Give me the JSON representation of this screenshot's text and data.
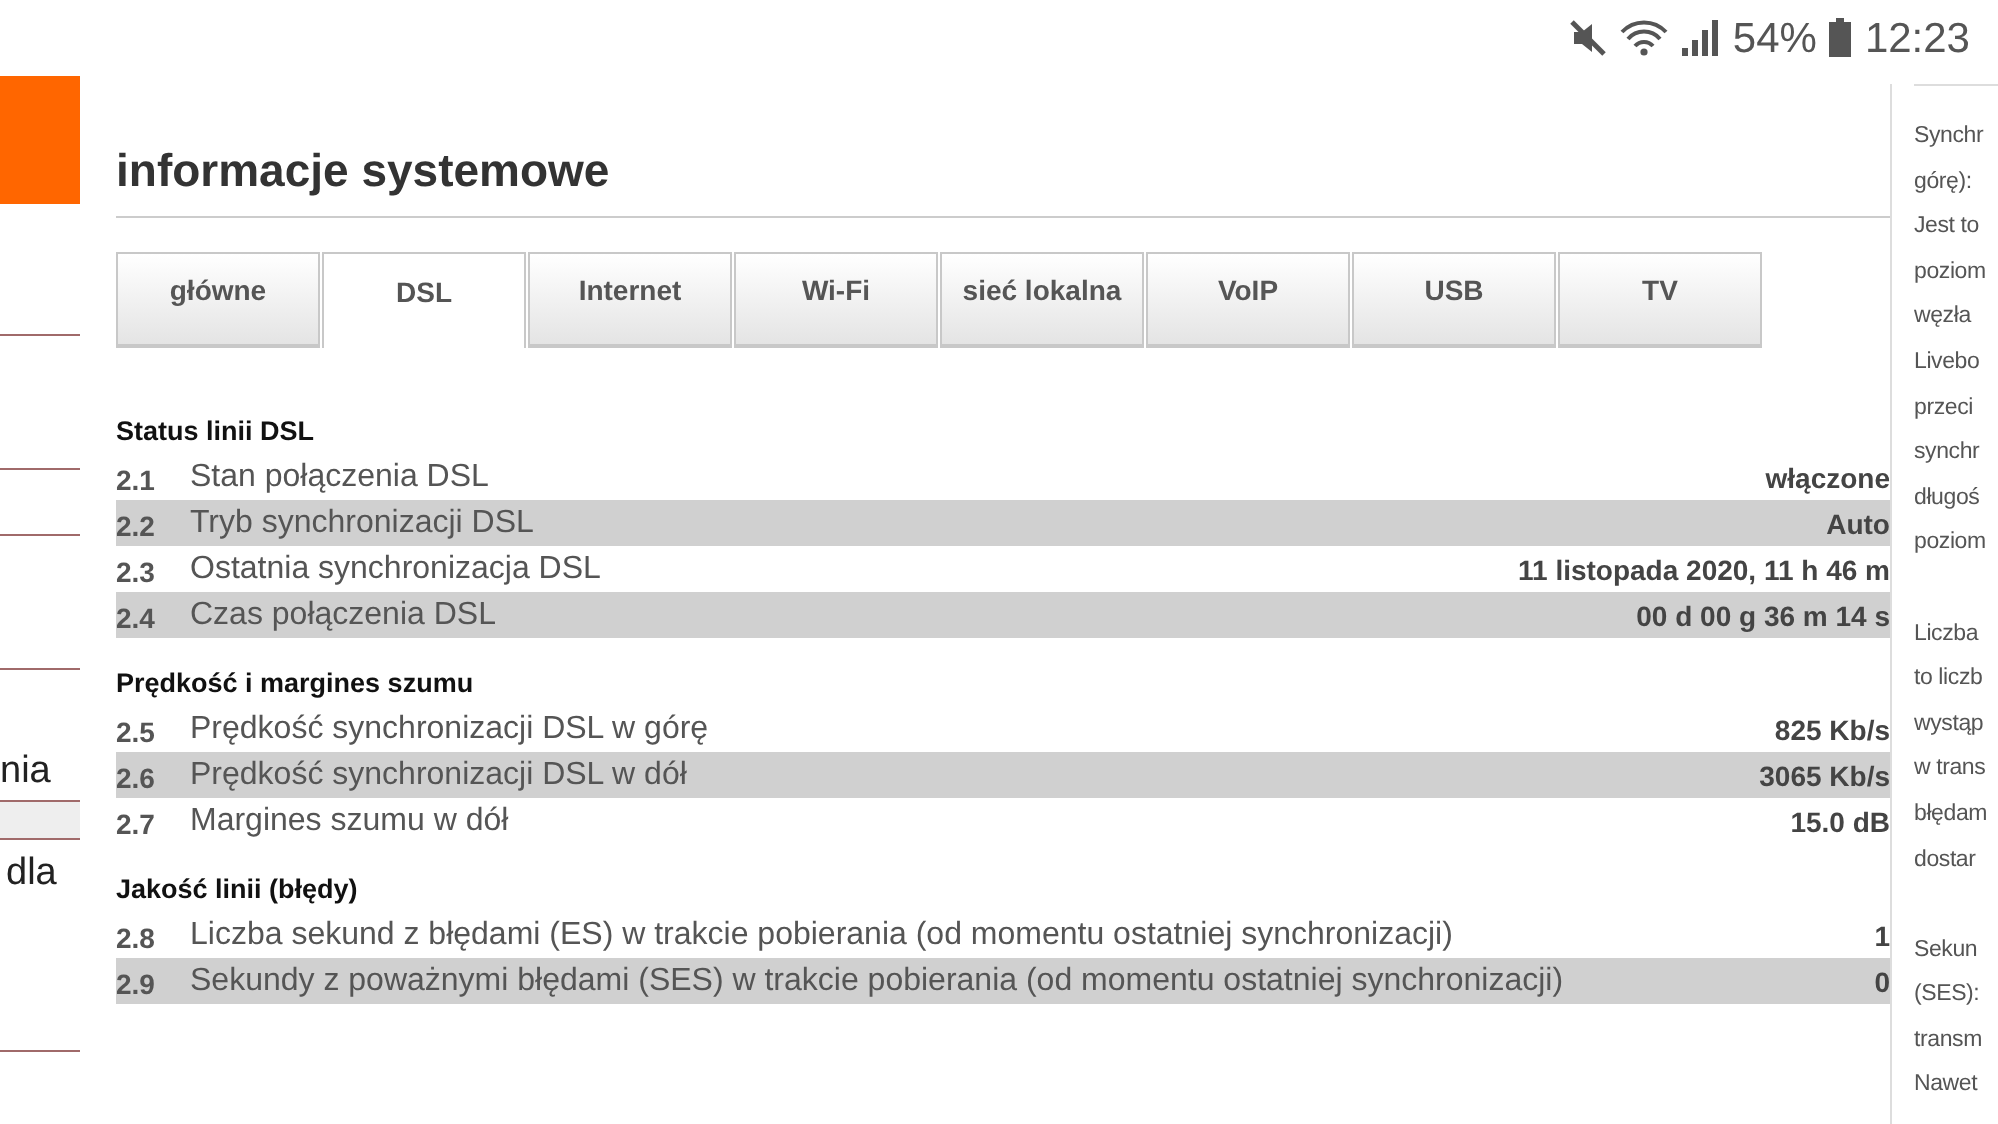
{
  "status_bar": {
    "battery": "54%",
    "time": "12:23"
  },
  "sidebar": {
    "items": [
      "nia",
      "dla"
    ]
  },
  "page": {
    "title": "informacje systemowe",
    "tabs": [
      {
        "label": "główne",
        "selected": false
      },
      {
        "label": "DSL",
        "selected": true
      },
      {
        "label": "Internet",
        "selected": false
      },
      {
        "label": "Wi-Fi",
        "selected": false
      },
      {
        "label": "sieć lokalna",
        "selected": false
      },
      {
        "label": "VoIP",
        "selected": false
      },
      {
        "label": "USB",
        "selected": false
      },
      {
        "label": "TV",
        "selected": false
      }
    ],
    "sections": [
      {
        "heading": "Status linii DSL",
        "rows": [
          {
            "number": "2.1",
            "label": "Stan połączenia DSL",
            "value": "włączone"
          },
          {
            "number": "2.2",
            "label": "Tryb synchronizacji DSL",
            "value": "Auto"
          },
          {
            "number": "2.3",
            "label": "Ostatnia synchronizacja DSL",
            "value": "11 listopada 2020, 11 h 46 m"
          },
          {
            "number": "2.4",
            "label": "Czas połączenia DSL",
            "value": "00 d 00 g 36 m 14 s"
          }
        ]
      },
      {
        "heading": "Prędkość i margines szumu",
        "rows": [
          {
            "number": "2.5",
            "label": "Prędkość synchronizacji DSL w górę",
            "value": "825 Kb/s"
          },
          {
            "number": "2.6",
            "label": "Prędkość synchronizacji DSL w dół",
            "value": "3065 Kb/s"
          },
          {
            "number": "2.7",
            "label": "Margines szumu w dół",
            "value": "15.0 dB"
          }
        ]
      },
      {
        "heading": "Jakość linii (błędy)",
        "rows": [
          {
            "number": "2.8",
            "label": "Liczba sekund z błędami (ES) w trakcie pobierania (od momentu ostatniej synchronizacji)",
            "value": "1"
          },
          {
            "number": "2.9",
            "label": "Sekundy z poważnymi błędami (SES) w trakcie pobierania (od momentu ostatniej synchronizacji)",
            "value": "0"
          }
        ]
      }
    ]
  },
  "help_panel": {
    "paragraphs": [
      [
        "Synchr",
        "górę):",
        "Jest to",
        "poziom",
        "węzła",
        "Livebo",
        "przeci",
        "synchr",
        "długoś",
        "poziom"
      ],
      [
        "Liczba",
        "to liczb",
        "wystąp",
        "w trans",
        "błędam",
        "dostar"
      ],
      [
        "Sekun",
        "(SES):",
        "transm",
        "Nawet"
      ]
    ]
  }
}
